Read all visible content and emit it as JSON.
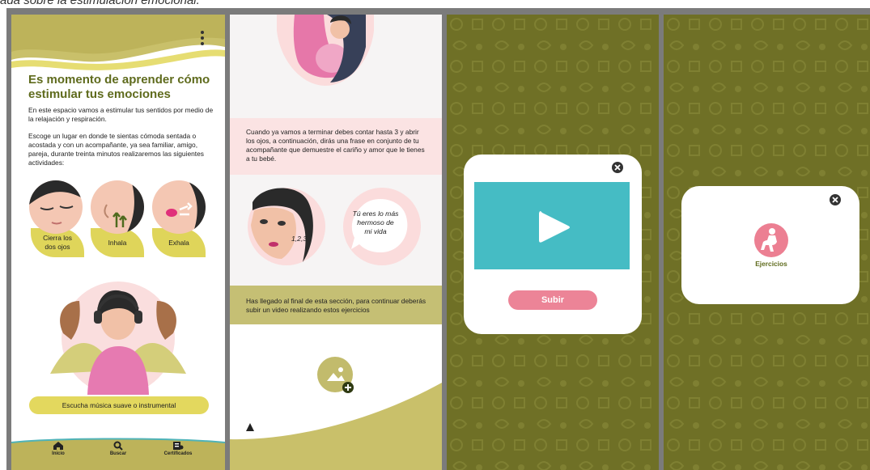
{
  "caption": "ada sobre la estimulación emocional.",
  "screen1": {
    "title": "Es momento de aprender cómo estimular tus emociones",
    "paragraph1": "En este espacio vamos a estimular tus sentidos por medio de la relajación y respiración.",
    "paragraph2": "Escoge un lugar en donde te sientas cómoda sentada o acostada y con un acompañante, ya sea familiar, amigo, pareja, durante treinta minutos realizaremos las siguientes actividades:",
    "steps": [
      {
        "label_line1": "Cierra los",
        "label_line2": "dos ojos"
      },
      {
        "label_line1": "Inhala",
        "label_line2": ""
      },
      {
        "label_line1": "Exhala",
        "label_line2": ""
      }
    ],
    "music_label": "Escucha música suave o instrumental",
    "tabs": [
      {
        "label": "Inicio",
        "icon": "home-icon"
      },
      {
        "label": "Buscar",
        "icon": "search-icon"
      },
      {
        "label": "Certificados",
        "icon": "certificate-icon"
      }
    ]
  },
  "screen2": {
    "instruction": "Cuando ya vamos a terminar debes contar hasta 3 y abrir los ojos, a continuación, dirás una frase en conjunto de tu acompañante que demuestre el cariño y amor que le tienes a tu bebé.",
    "count_text": "1,2,3",
    "quote_line1": "Tú eres lo más",
    "quote_line2": "hermoso de",
    "quote_line3": "mi vida",
    "end_text": "Has llegado al final de esta sección, para continuar deberás subir un video realizando estos ejercicios"
  },
  "screen3": {
    "upload_label": "Subir"
  },
  "screen4": {
    "exercise_label": "Ejercicios"
  },
  "colors": {
    "olive": "#6f7026",
    "olive_text": "#5f6b1d",
    "yellow": "#dfd55a",
    "pink": "#ec8497",
    "teal": "#45bcc4"
  }
}
